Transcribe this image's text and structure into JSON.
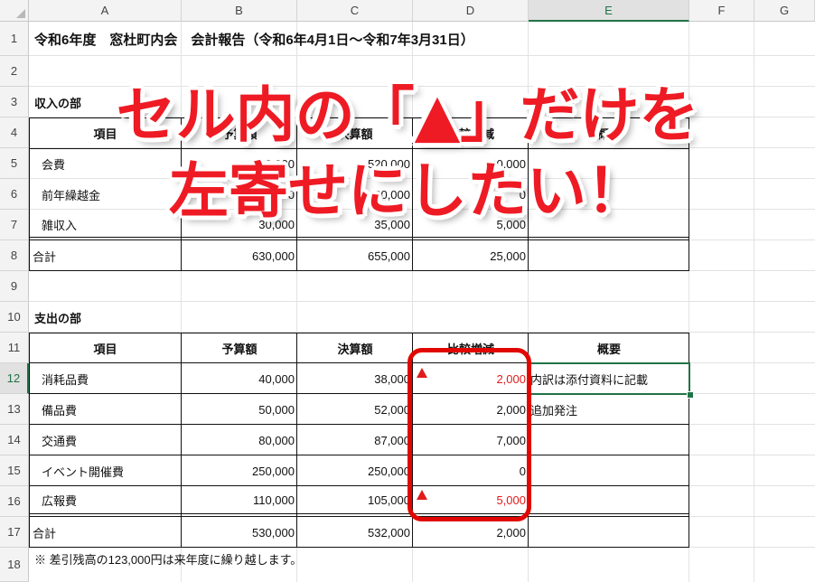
{
  "columns": [
    "A",
    "B",
    "C",
    "D",
    "E",
    "F",
    "G"
  ],
  "selected_column": "E",
  "rows": [
    "1",
    "2",
    "3",
    "4",
    "5",
    "6",
    "7",
    "8",
    "9",
    "10",
    "11",
    "12",
    "13",
    "14",
    "15",
    "16",
    "17",
    "18"
  ],
  "selected_row": "12",
  "title": "令和6年度　窓杜町内会　会計報告（令和6年4月1日～令和7年3月31日）",
  "income": {
    "section_label": "収入の部",
    "headers": [
      "項目",
      "予算額",
      "決算額",
      "比較増減",
      "概要"
    ],
    "rows": [
      {
        "item": "会費",
        "budget": "500,000",
        "actual": "520,000",
        "diff": "20,000"
      },
      {
        "item": "前年繰越金",
        "budget": "100,000",
        "actual": "100,000",
        "diff": "0"
      },
      {
        "item": "雑収入",
        "budget": "30,000",
        "actual": "35,000",
        "diff": "5,000"
      }
    ],
    "total": {
      "label": "合計",
      "budget": "630,000",
      "actual": "655,000",
      "diff": "25,000"
    }
  },
  "expense": {
    "section_label": "支出の部",
    "headers": [
      "項目",
      "予算額",
      "決算額",
      "比較増減",
      "概要"
    ],
    "rows": [
      {
        "item": "消耗品費",
        "budget": "40,000",
        "actual": "38,000",
        "diff": "2,000",
        "negative": true,
        "note": "内訳は添付資料に記載"
      },
      {
        "item": "備品費",
        "budget": "50,000",
        "actual": "52,000",
        "diff": "2,000",
        "negative": false,
        "note": "追加発注"
      },
      {
        "item": "交通費",
        "budget": "80,000",
        "actual": "87,000",
        "diff": "7,000",
        "negative": false,
        "note": ""
      },
      {
        "item": "イベント開催費",
        "budget": "250,000",
        "actual": "250,000",
        "diff": "0",
        "negative": false,
        "note": ""
      },
      {
        "item": "広報費",
        "budget": "110,000",
        "actual": "105,000",
        "diff": "5,000",
        "negative": true,
        "note": ""
      }
    ],
    "total": {
      "label": "合計",
      "budget": "530,000",
      "actual": "532,000",
      "diff": "2,000"
    }
  },
  "footnote": "※ 差引残高の123,000円は来年度に繰り越します。",
  "overlay": {
    "line1": "セル内の「▲」だけを",
    "line2": "左寄せにしたい！"
  },
  "colors": {
    "accent_red": "#e01b1b",
    "excel_green": "#217346",
    "highlight_frame": "#e10600"
  }
}
